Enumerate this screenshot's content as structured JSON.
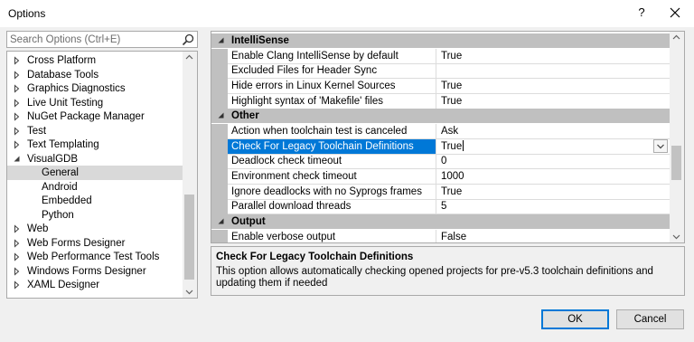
{
  "window": {
    "title": "Options",
    "help_label": "?"
  },
  "search": {
    "placeholder": "Search Options (Ctrl+E)"
  },
  "tree": {
    "items": [
      {
        "label": "Cross Platform",
        "expanded": false
      },
      {
        "label": "Database Tools",
        "expanded": false
      },
      {
        "label": "Graphics Diagnostics",
        "expanded": false
      },
      {
        "label": "Live Unit Testing",
        "expanded": false
      },
      {
        "label": "NuGet Package Manager",
        "expanded": false
      },
      {
        "label": "Test",
        "expanded": false
      },
      {
        "label": "Text Templating",
        "expanded": false
      },
      {
        "label": "VisualGDB",
        "expanded": true
      },
      {
        "label": "General",
        "child": true,
        "selected": true
      },
      {
        "label": "Android",
        "child": true
      },
      {
        "label": "Embedded",
        "child": true
      },
      {
        "label": "Python",
        "child": true
      },
      {
        "label": "Web",
        "expanded": false
      },
      {
        "label": "Web Forms Designer",
        "expanded": false
      },
      {
        "label": "Web Performance Test Tools",
        "expanded": false
      },
      {
        "label": "Windows Forms Designer",
        "expanded": false
      },
      {
        "label": "XAML Designer",
        "expanded": false
      }
    ]
  },
  "grid": {
    "categories": [
      {
        "name": "IntelliSense",
        "properties": [
          {
            "name": "Enable Clang IntelliSense by default",
            "value": "True"
          },
          {
            "name": "Excluded Files for Header Sync",
            "value": ""
          },
          {
            "name": "Hide errors in Linux Kernel Sources",
            "value": "True"
          },
          {
            "name": "Highlight syntax of 'Makefile' files",
            "value": "True"
          }
        ]
      },
      {
        "name": "Other",
        "properties": [
          {
            "name": "Action when toolchain test is canceled",
            "value": "Ask"
          },
          {
            "name": "Check For Legacy Toolchain Definitions",
            "value": "True",
            "selected": true
          },
          {
            "name": "Deadlock check timeout",
            "value": "0"
          },
          {
            "name": "Environment check timeout",
            "value": "1000"
          },
          {
            "name": "Ignore deadlocks with no Syprogs frames",
            "value": "True"
          },
          {
            "name": "Parallel download threads",
            "value": "5"
          }
        ]
      },
      {
        "name": "Output",
        "properties": [
          {
            "name": "Enable verbose output",
            "value": "False"
          }
        ]
      }
    ]
  },
  "description": {
    "title": "Check For Legacy Toolchain Definitions",
    "text": "This option allows automatically checking opened projects for pre-v5.3 toolchain definitions and updating them if needed"
  },
  "buttons": {
    "ok": "OK",
    "cancel": "Cancel"
  },
  "colors": {
    "selection": "#0078d7",
    "category_band": "#c0c0c0",
    "tree_selection": "#d9d9d9"
  }
}
